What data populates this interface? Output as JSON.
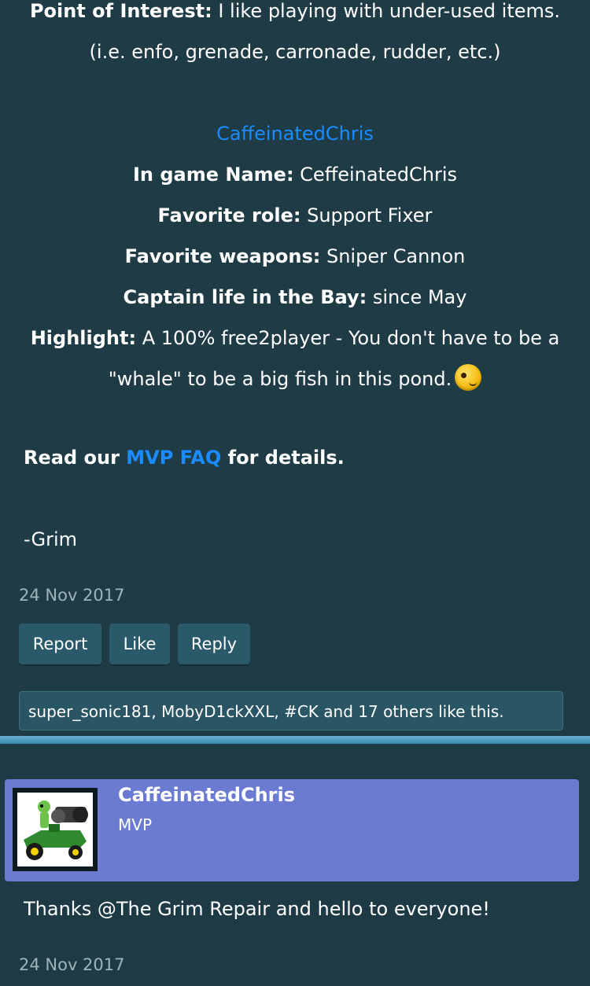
{
  "post1": {
    "poi_label": "Point of Interest:",
    "poi_value": " I like playing with under-used items.",
    "poi_examples": "(i.e. enfo, grenade, carronade, rudder, etc.)",
    "mvp_name_link": "CaffeinatedChris",
    "fields": [
      {
        "label": "In game Name:",
        "value": " CeffeinatedChris"
      },
      {
        "label": "Favorite role:",
        "value": " Support Fixer"
      },
      {
        "label": "Favorite weapons:",
        "value": " Sniper Cannon"
      },
      {
        "label": "Captain life in the Bay:",
        "value": " since May"
      }
    ],
    "highlight_label": "Highlight:",
    "highlight_line1": " A 100% free2player - You don't have to be a",
    "highlight_line2": "\"whale\" to be a big fish in this pond.",
    "smiley_icon": "wink-smiley-icon",
    "read_prefix": "Read our ",
    "read_link": "MVP FAQ",
    "read_suffix": " for details.",
    "signature": "-Grim",
    "date": "24 Nov 2017",
    "buttons": {
      "report": "Report",
      "like": "Like",
      "reply": "Reply"
    },
    "likes_text": "super_sonic181, MobyD1ckXXL, #CK and 17 others like this."
  },
  "post2": {
    "username": "CaffeinatedChris",
    "role": "MVP",
    "message": "Thanks @The Grim Repair and hello to everyone!",
    "date": "24 Nov 2017"
  },
  "colors": {
    "background": "#1e3a44",
    "link": "#1a8cff",
    "user_bar": "#6b7bd1",
    "button": "#2a5a6a"
  }
}
